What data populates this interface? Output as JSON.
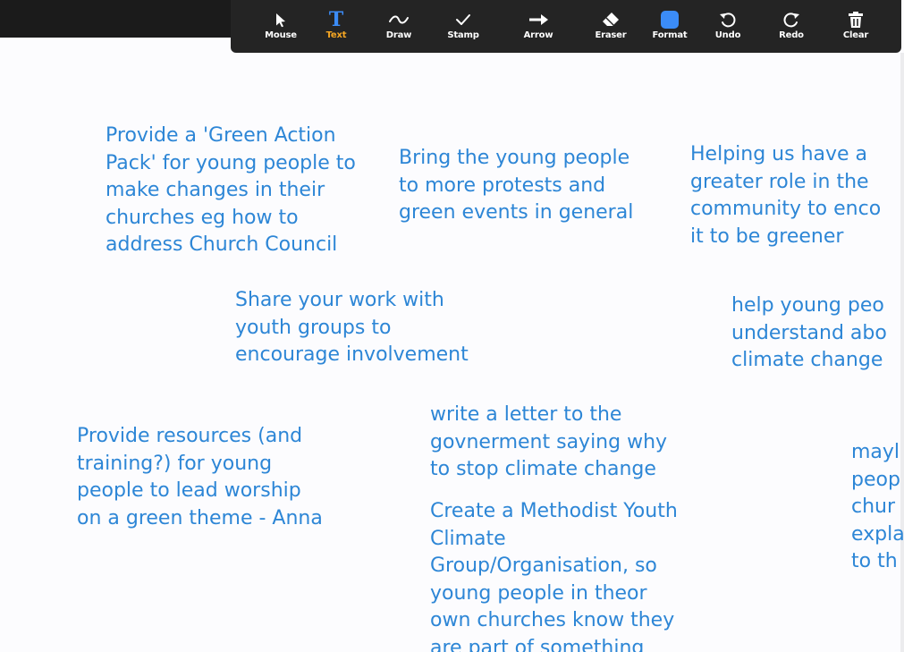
{
  "toolbar": {
    "tools": [
      {
        "id": "mouse",
        "label": "Mouse",
        "icon": "mouse-pointer-icon"
      },
      {
        "id": "text",
        "label": "Text",
        "icon": "text-T-icon",
        "active": true
      },
      {
        "id": "draw",
        "label": "Draw",
        "icon": "draw-squiggle-icon"
      },
      {
        "id": "stamp",
        "label": "Stamp",
        "icon": "stamp-checkmark-icon"
      },
      {
        "id": "arrow",
        "label": "Arrow",
        "icon": "arrow-right-icon"
      },
      {
        "id": "eraser",
        "label": "Eraser",
        "icon": "eraser-icon"
      },
      {
        "id": "format",
        "label": "Format",
        "icon": "format-color-square-icon"
      },
      {
        "id": "undo",
        "label": "Undo",
        "icon": "undo-icon"
      },
      {
        "id": "redo",
        "label": "Redo",
        "icon": "redo-icon"
      },
      {
        "id": "clear",
        "label": "Clear",
        "icon": "trash-can-icon"
      }
    ],
    "active_color": "#f5a623",
    "format_color": "#3b8cf7"
  },
  "notes": {
    "green_action_pack": "Provide a 'Green Action\nPack' for young people to\nmake changes in their\nchurches eg how to\naddress Church Council",
    "protests": "Bring the young people\nto more protests and\ngreen events in general",
    "community": "Helping us have a\ngreater role in the\ncommunity to enco\nit to be greener",
    "share_work": "Share your work with\nyouth groups to\nencourage involvement",
    "understand": "help young peo\nunderstand abo\nclimate change",
    "resources": "Provide resources (and\ntraining?) for young\npeople to lead worship\non a green theme - Anna",
    "letter": "write a letter to the\ngovnerment saying why\nto stop climate change",
    "methodist_group": "Create a Methodist Youth\nClimate\nGroup/Organisation, so\nyoung people in theor\nown churches know they\nare part of something",
    "maybe": "mayl\npeop\nchur\nexpla\nto th"
  },
  "text_color": "#2d86d6"
}
